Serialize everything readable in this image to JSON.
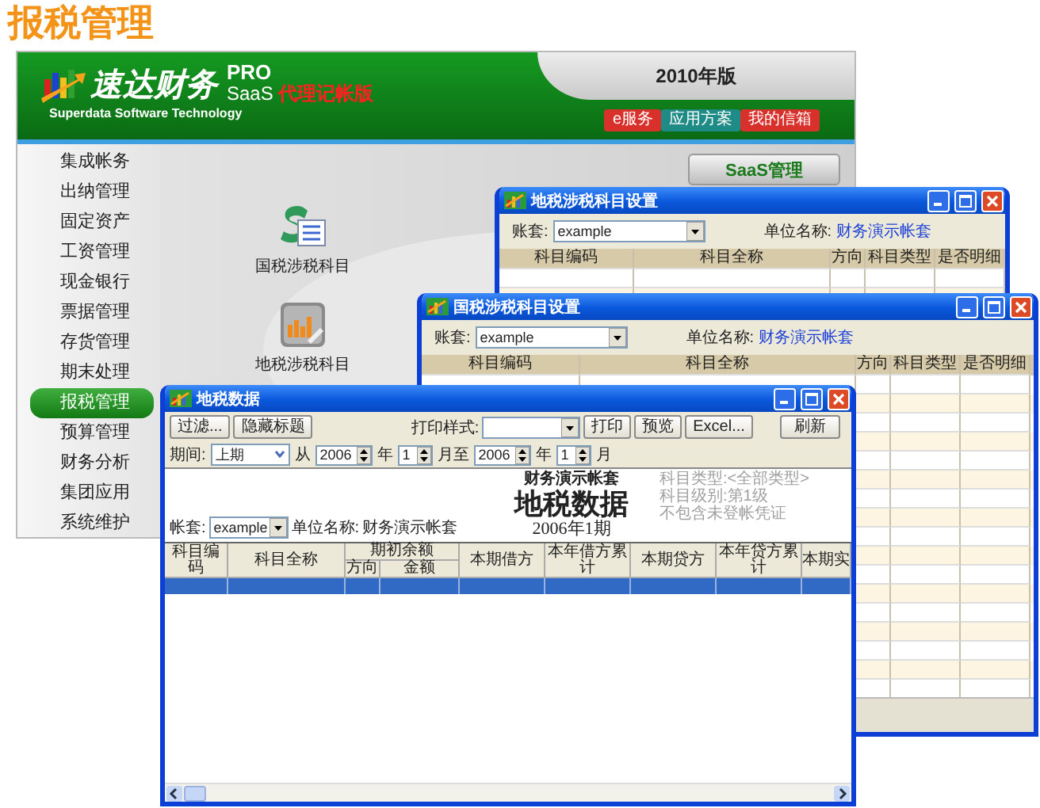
{
  "page_title": "报税管理",
  "app": {
    "logo": {
      "name": "速达财务",
      "badge": "PRO",
      "product": "SaaS",
      "edition": "代理记帐版",
      "tagline": "Superdata Software Technology"
    },
    "version": "2010年版",
    "header_buttons": [
      {
        "label": "e服务",
        "color": "#d8312c"
      },
      {
        "label": "应用方案",
        "color": "#1f8b86"
      },
      {
        "label": "我的信箱",
        "color": "#d8312c"
      }
    ],
    "sidebar": {
      "items": [
        {
          "label": "集成帐务",
          "selected": false
        },
        {
          "label": "出纳管理",
          "selected": false
        },
        {
          "label": "固定资产",
          "selected": false
        },
        {
          "label": "工资管理",
          "selected": false
        },
        {
          "label": "现金银行",
          "selected": false
        },
        {
          "label": "票据管理",
          "selected": false
        },
        {
          "label": "存货管理",
          "selected": false
        },
        {
          "label": "期末处理",
          "selected": false
        },
        {
          "label": "报税管理",
          "selected": true
        },
        {
          "label": "预算管理",
          "selected": false
        },
        {
          "label": "财务分析",
          "selected": false
        },
        {
          "label": "集团应用",
          "selected": false
        },
        {
          "label": "系统维护",
          "selected": false
        }
      ]
    },
    "saas_button": "SaaS管理",
    "modules": [
      {
        "label": "国税涉税科目",
        "kind": "money"
      },
      {
        "label": "地税涉税科目",
        "kind": "chart"
      }
    ]
  },
  "windows": [
    {
      "kind": "setup",
      "title": "地税涉税科目设置",
      "account_label": "账套:",
      "account": "example",
      "unit_label": "单位名称:",
      "unit": "财务演示帐套",
      "columns": [
        "科目编码",
        "科目全称",
        "方向",
        "科目类型",
        "是否明细"
      ]
    },
    {
      "kind": "setup",
      "title": "国税涉税科目设置",
      "account_label": "账套:",
      "account": "example",
      "unit_label": "单位名称:",
      "unit": "财务演示帐套",
      "columns": [
        "科目编码",
        "科目全称",
        "方向",
        "科目类型",
        "是否明细"
      ]
    },
    {
      "kind": "report",
      "title": "地税数据",
      "toolbar": {
        "left_buttons": [
          "过滤...",
          "隐藏标题"
        ],
        "print_style_label": "打印样式:",
        "print_buttons": [
          "打印",
          "预览",
          "Excel..."
        ],
        "refresh": "刷新"
      },
      "period": {
        "label": "期间:",
        "value": "上期",
        "from": "从",
        "from_year": "2006",
        "from_year_unit": "年",
        "from_month": "1",
        "to": "月至",
        "to_year": "2006",
        "to_year_unit": "年",
        "to_month": "1",
        "month_unit": "月"
      },
      "report": {
        "company": "财务演示帐套",
        "title": "地税数据",
        "period": "2006年1期",
        "account_label": "帐套:",
        "account": "example",
        "unit_label": "单位名称:",
        "unit": "财务演示帐套",
        "filters": [
          "科目类型:<全部类型>",
          "科目级别:第1级",
          "不包含未登帐凭证"
        ]
      },
      "table": {
        "columns": [
          {
            "label": "科目编码"
          },
          {
            "label": "科目全称"
          },
          {
            "label": "期初余额",
            "children": [
              "方向",
              "金额"
            ]
          },
          {
            "label": "本期借方"
          },
          {
            "label": "本年借方累计"
          },
          {
            "label": "本期贷方"
          },
          {
            "label": "本年贷方累计"
          },
          {
            "label": "本期实"
          }
        ],
        "rows": [
          {
            "selected": true
          }
        ]
      }
    }
  ]
}
